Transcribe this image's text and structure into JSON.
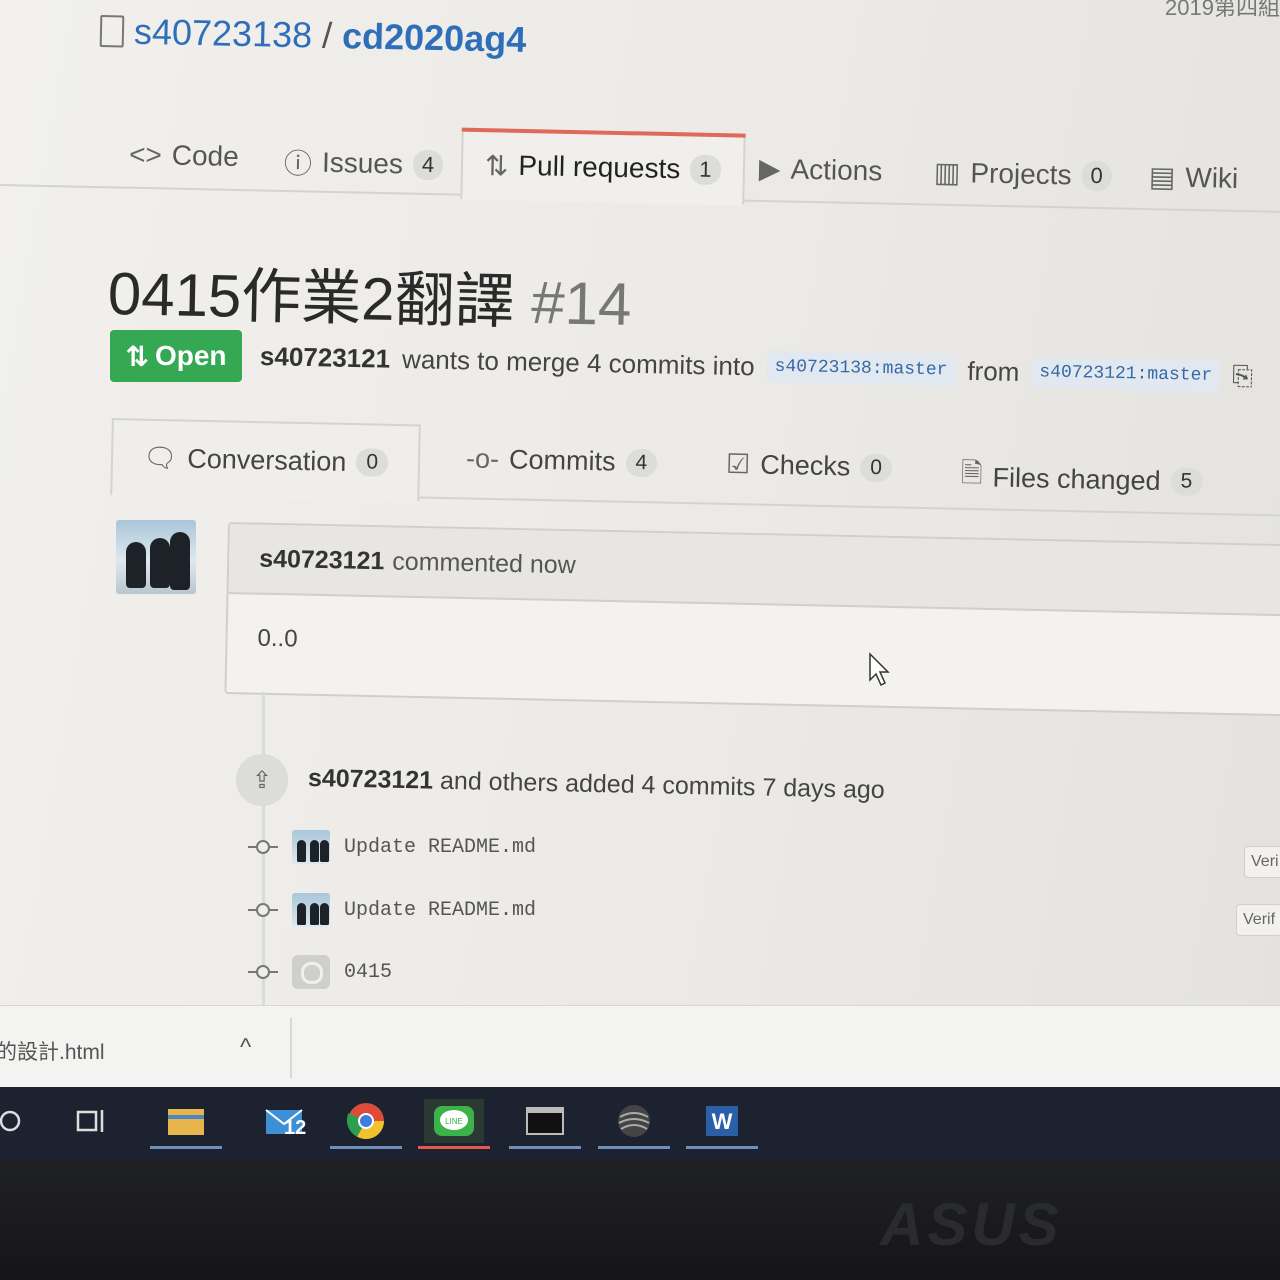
{
  "repo": {
    "owner": "s40723138",
    "separator": "/",
    "name": "cd2020ag4",
    "corner_text": "2019第四組"
  },
  "tabs": [
    {
      "label": "Code",
      "count": "",
      "icon": "code-icon"
    },
    {
      "label": "Issues",
      "count": "4",
      "icon": "issue-icon"
    },
    {
      "label": "Pull requests",
      "count": "1",
      "icon": "pull-request-icon",
      "selected": true
    },
    {
      "label": "Actions",
      "count": "",
      "icon": "play-icon"
    },
    {
      "label": "Projects",
      "count": "0",
      "icon": "project-icon"
    },
    {
      "label": "Wiki",
      "count": "",
      "icon": "book-icon"
    }
  ],
  "pr": {
    "title": "0415作業2翻譯",
    "number": "#14",
    "state": "Open",
    "author": "s40723121",
    "meta_text": "wants to merge 4 commits into",
    "base_branch": "s40723138:master",
    "from_text": "from",
    "head_branch": "s40723121:master"
  },
  "subtabs": [
    {
      "label": "Conversation",
      "count": "0"
    },
    {
      "label": "Commits",
      "count": "4"
    },
    {
      "label": "Checks",
      "count": "0"
    },
    {
      "label": "Files changed",
      "count": "5"
    }
  ],
  "comment": {
    "author": "s40723121",
    "action": "commented now",
    "body": "0..0"
  },
  "timeline": {
    "author": "s40723121",
    "text": "and others added 4 commits 7 days ago",
    "commits": [
      {
        "message": "Update README.md",
        "badge": "Veri"
      },
      {
        "message": "Update README.md",
        "badge": "Verif"
      },
      {
        "message": "0415",
        "badge": ""
      }
    ]
  },
  "download": {
    "filename": "的設計.html",
    "chevron": "^"
  },
  "taskbar": {
    "mail_count": "12",
    "line_label": "LINE"
  },
  "bezel": {
    "brand": "ASUS"
  },
  "colors": {
    "open_green": "#34a853",
    "link_blue": "#2f6fba",
    "tab_accent": "#e06a5a"
  }
}
